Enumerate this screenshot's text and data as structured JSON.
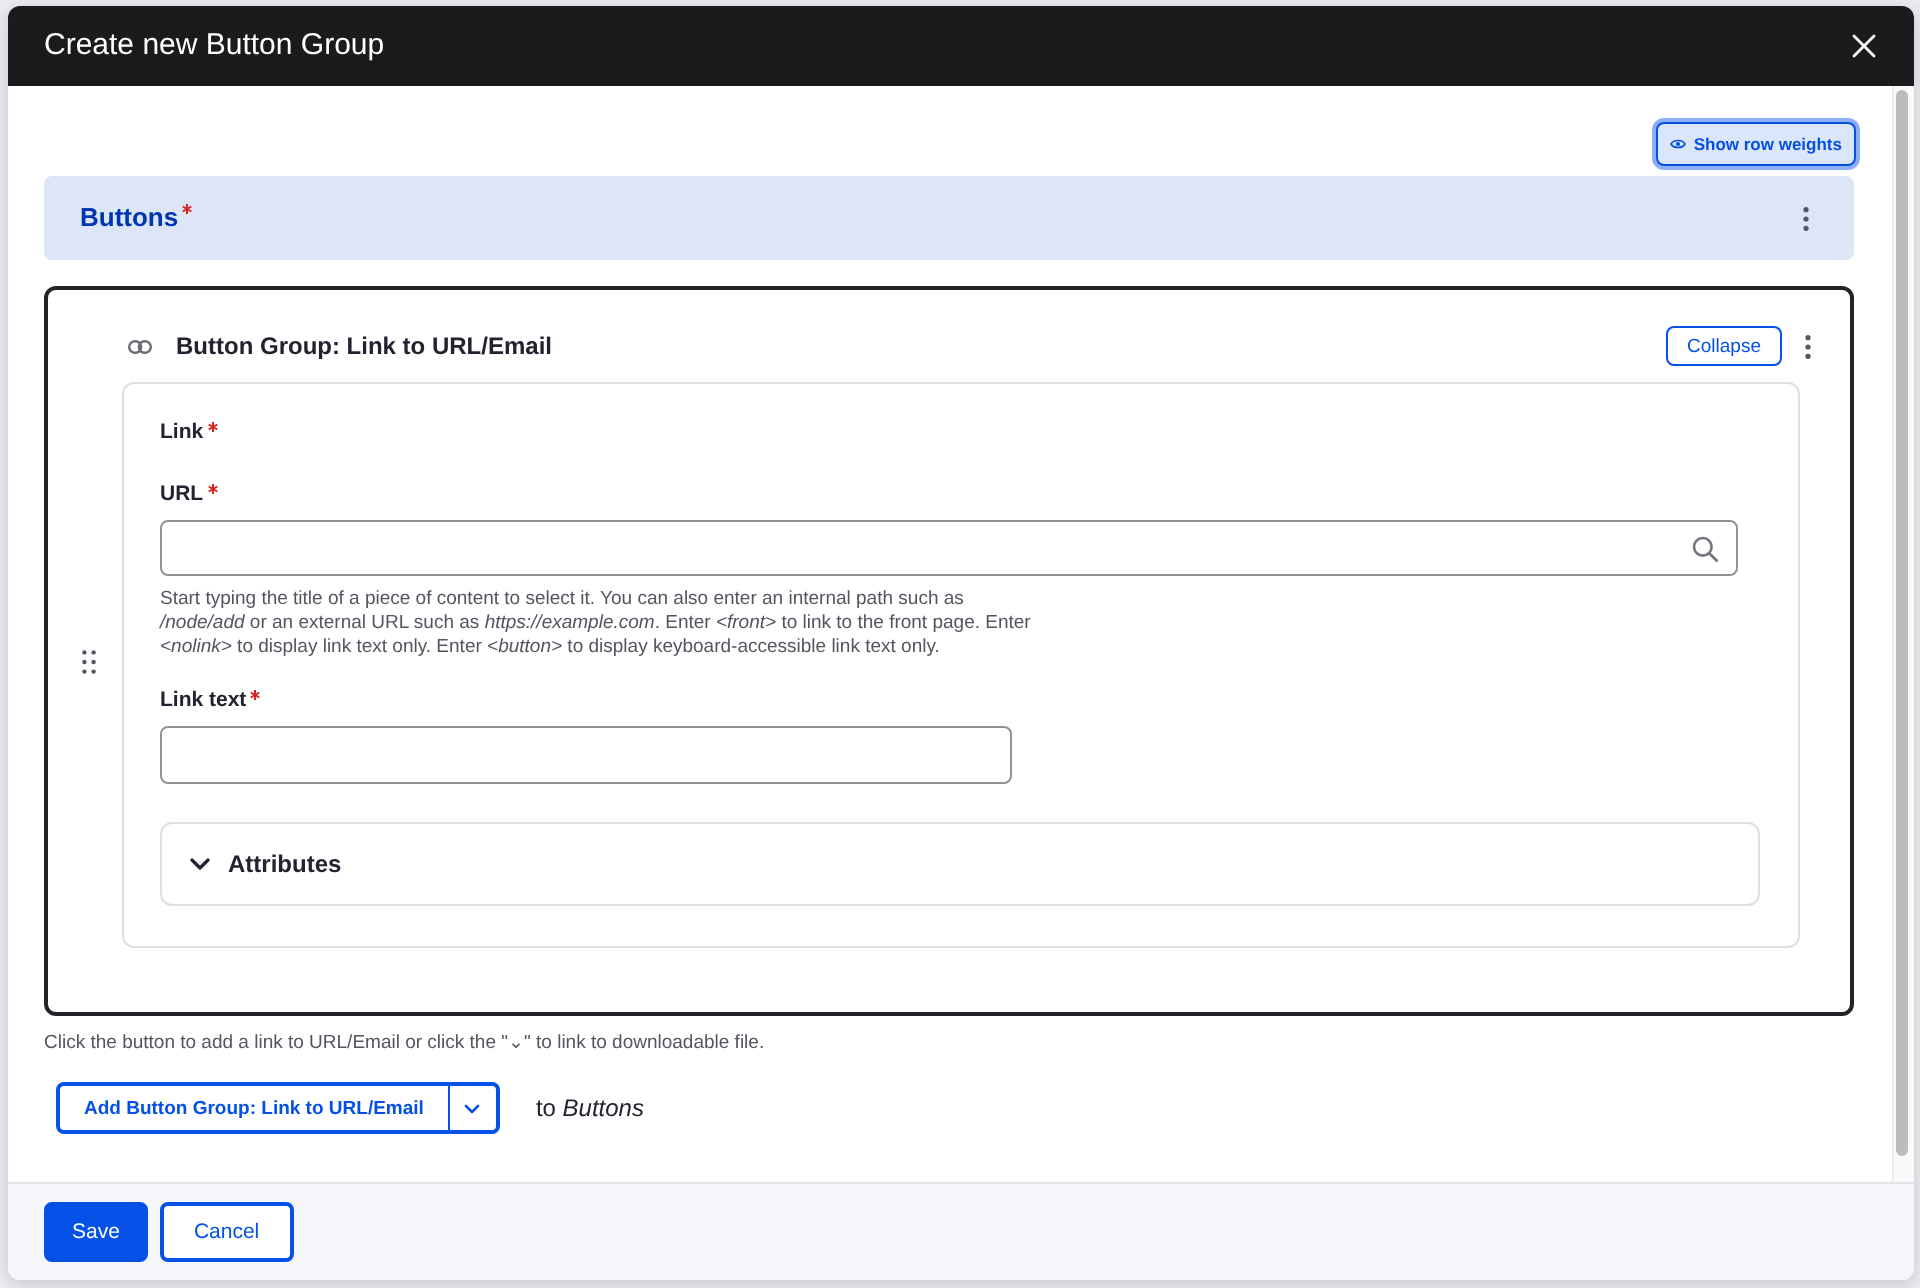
{
  "dialog": {
    "title": "Create new Button Group"
  },
  "toolbar": {
    "show_row_weights": {
      "label": "Show row weights",
      "focused": true
    }
  },
  "field": {
    "label": "Buttons",
    "required": true
  },
  "paragraph": {
    "title": "Button Group: Link to URL/Email",
    "collapse_label": "Collapse",
    "fields": [
      {
        "kind": "group",
        "label": "Link",
        "required": true
      },
      {
        "kind": "autocomplete",
        "label": "URL",
        "required": true,
        "description": "Start typing the title of a piece of content to select it. You can also enter an internal path such as */node/add* or an external URL such as *https://example.com*. Enter *<front>* to link to the front page. Enter *<nolink>* to display link text only. Enter *<button>* to display keyboard-accessible link text only."
      },
      {
        "kind": "text",
        "label": "Link text",
        "required": true
      },
      {
        "kind": "details",
        "label": "Attributes",
        "expanded": false
      }
    ]
  },
  "add_more": {
    "help": "Click the button to add a link to URL/Email or click the \"⌄\" to link to downloadable file.",
    "button_label": "Add Button Group: Link to URL/Email",
    "target": "to *Buttons*"
  },
  "footer": {
    "buttons": [
      {
        "label": "Save",
        "kind": "primary"
      },
      {
        "label": "Cancel",
        "kind": "secondary"
      }
    ]
  }
}
